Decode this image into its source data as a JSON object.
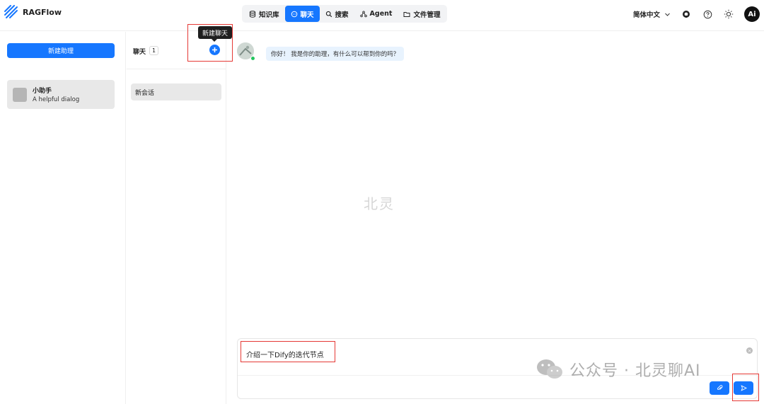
{
  "app": {
    "name": "RAGFlow"
  },
  "nav": {
    "items": [
      {
        "label": "知识库",
        "icon": "database-icon",
        "active": false
      },
      {
        "label": "聊天",
        "icon": "chat-icon",
        "active": true
      },
      {
        "label": "搜索",
        "icon": "search-icon",
        "active": false
      },
      {
        "label": "Agent",
        "icon": "agent-icon",
        "active": false
      },
      {
        "label": "文件管理",
        "icon": "folder-icon",
        "active": false
      }
    ]
  },
  "header": {
    "language": "简体中文",
    "avatar_text": "Ai"
  },
  "sidebar": {
    "new_assistant_label": "新建助理",
    "assistants": [
      {
        "name": "小助手",
        "description": "A helpful dialog"
      }
    ]
  },
  "chats": {
    "title": "聊天",
    "count": "1",
    "new_chat_tooltip": "新建聊天",
    "sessions": [
      {
        "label": "新会话"
      }
    ]
  },
  "conversation": {
    "bot_greeting": "你好！ 我是你的助理，有什么可以帮到你的吗？",
    "watermark": "北灵"
  },
  "composer": {
    "value": "介绍一下Dify的迭代节点"
  },
  "overlay": {
    "wechat_watermark": "公众号 · 北灵聊AI"
  },
  "colors": {
    "accent": "#1677ff",
    "highlight": "#e53935",
    "online": "#22c55e"
  }
}
